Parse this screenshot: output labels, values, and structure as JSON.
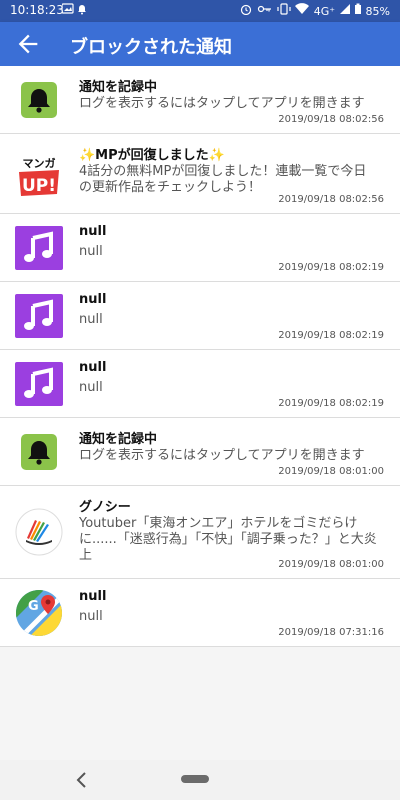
{
  "status_bar": {
    "time": "10:18:23",
    "right_text": "4G⁺",
    "battery": "85%"
  },
  "app_bar": {
    "title": "ブロックされた通知"
  },
  "items": [
    {
      "icon": "bell-app-icon",
      "title": "通知を記録中",
      "body": "ログを表示するにはタップしてアプリを開きます",
      "time": "2019/09/18 08:02:56"
    },
    {
      "icon": "manga-up-app-icon",
      "title": "✨MPが回復しました✨",
      "body": "4話分の無料MPが回復しました！連載一覧で今日の更新作品をチェックしよう！",
      "time": "2019/09/18 08:02:56"
    },
    {
      "icon": "music-app-icon",
      "title": "null",
      "body": "null",
      "time": "2019/09/18 08:02:19"
    },
    {
      "icon": "music-app-icon",
      "title": "null",
      "body": "null",
      "time": "2019/09/18 08:02:19"
    },
    {
      "icon": "music-app-icon",
      "title": "null",
      "body": "null",
      "time": "2019/09/18 08:02:19"
    },
    {
      "icon": "bell-app-icon",
      "title": "通知を記録中",
      "body": "ログを表示するにはタップしてアプリを開きます",
      "time": "2019/09/18 08:01:00"
    },
    {
      "icon": "gunosy-app-icon",
      "title": "グノシー",
      "body": "Youtuber「東海オンエア」ホテルをゴミだらけに......「迷惑行為」「不快」「調子乗った？」と大炎上",
      "time": "2019/09/18 08:01:00"
    },
    {
      "icon": "google-maps-icon",
      "title": "null",
      "body": "null",
      "time": "2019/09/18 07:31:16"
    }
  ],
  "colors": {
    "status_bar": "#2f55a8",
    "app_bar": "#3b6fd6",
    "bell_green": "#8bc34a",
    "music_purple": "#9b3fe0"
  }
}
